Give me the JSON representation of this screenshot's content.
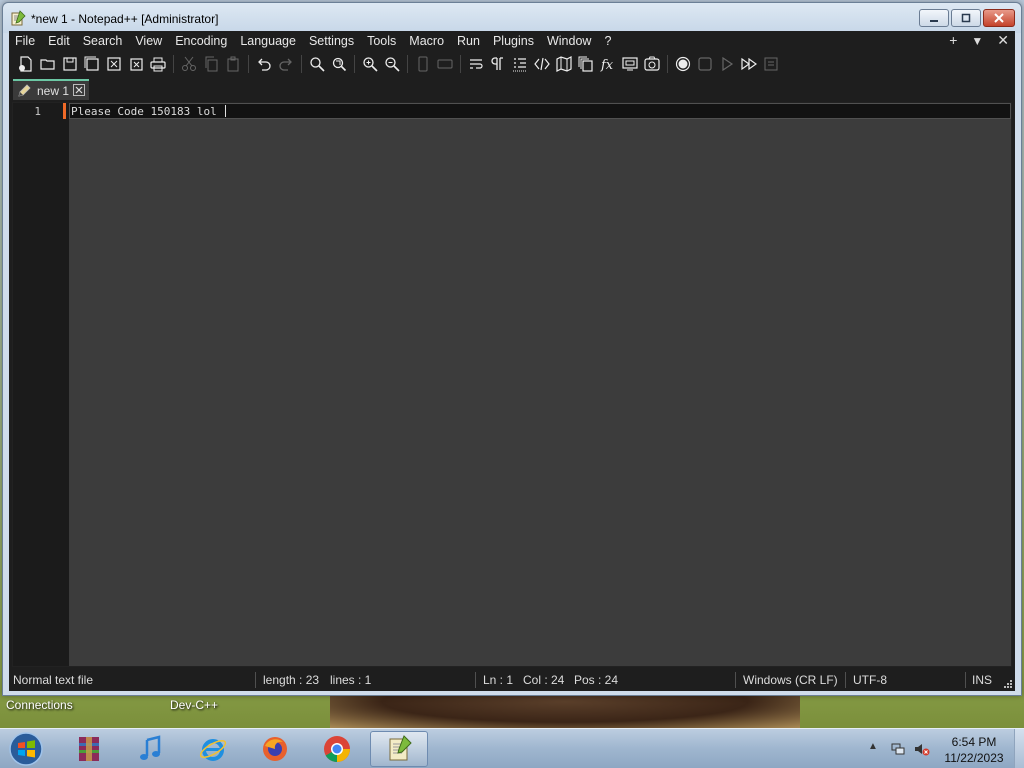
{
  "window": {
    "title": "*new 1 - Notepad++ [Administrator]"
  },
  "menubar": {
    "items": [
      "File",
      "Edit",
      "Search",
      "View",
      "Encoding",
      "Language",
      "Settings",
      "Tools",
      "Macro",
      "Run",
      "Plugins",
      "Window",
      "?"
    ],
    "right_icons": [
      "plus-icon",
      "dropdown-icon",
      "close-icon"
    ],
    "plus": "+",
    "dropdown": "▼",
    "close": "✕"
  },
  "toolbar": {
    "icons": [
      "new-file-icon",
      "open-file-icon",
      "save-icon",
      "save-all-icon",
      "close-icon",
      "close-all-icon",
      "print-icon",
      "cut-icon",
      "copy-icon",
      "paste-icon",
      "undo-icon",
      "redo-icon",
      "find-icon",
      "replace-icon",
      "zoom-in-icon",
      "zoom-out-icon",
      "sync-vertical-icon",
      "sync-horizontal-icon",
      "word-wrap-icon",
      "show-all-chars-icon",
      "indent-guide-icon",
      "language-icon",
      "document-map-icon",
      "document-list-icon",
      "function-list-icon",
      "folder-workspace-icon",
      "monitoring-icon",
      "record-macro-icon",
      "stop-macro-icon",
      "play-macro-icon",
      "run-macro-multiple-icon",
      "save-macro-icon"
    ]
  },
  "tabs": [
    {
      "label": "new 1",
      "icon": "pencil-icon",
      "active": true
    }
  ],
  "editor": {
    "line_number": "1",
    "line_text": "Please Code 150183 lol "
  },
  "statusbar": {
    "file_type": "Normal text file",
    "length": "length : 23",
    "lines": "lines : 1",
    "ln": "Ln : 1",
    "col": "Col : 24",
    "pos": "Pos : 24",
    "eol": "Windows (CR LF)",
    "encoding": "UTF-8",
    "mode": "INS"
  },
  "desktop": {
    "labels": [
      "Connections",
      "Dev-C++"
    ]
  },
  "taskbar": {
    "apps": [
      "winrar-icon",
      "itunes-icon",
      "internet-explorer-icon",
      "firefox-icon",
      "chrome-icon",
      "notepad-plus-plus-icon"
    ],
    "active_app": "notepad-plus-plus-icon",
    "time": "6:54 PM",
    "date": "11/22/2023"
  },
  "colors": {
    "editor_bg": "#3c3c3c",
    "gutter_bg": "#1b1b1b",
    "tab_accent": "#6cc7a4",
    "line_marker": "#f06a28"
  }
}
